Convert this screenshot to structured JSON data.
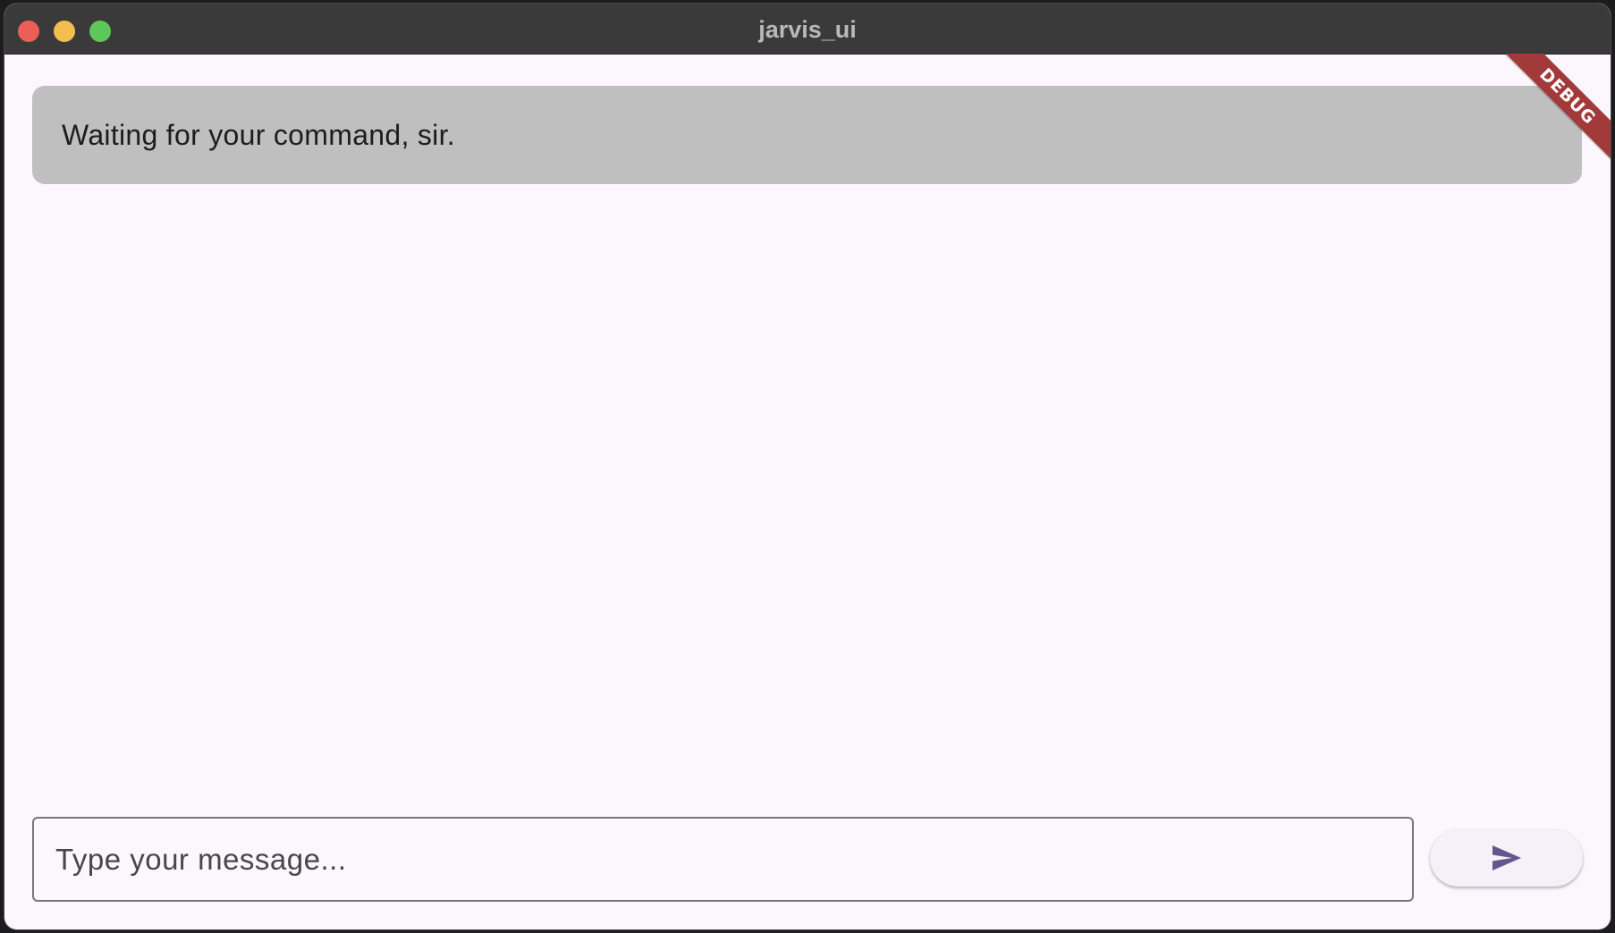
{
  "window": {
    "title": "jarvis_ui"
  },
  "chat": {
    "messages": [
      {
        "text": "Waiting for your command, sir."
      }
    ]
  },
  "composer": {
    "placeholder": "Type your message...",
    "value": "",
    "send_icon": "send-icon"
  },
  "debug_banner": {
    "label": "DEBUG"
  },
  "colors": {
    "titlebar": "#3a3a3a",
    "background": "#fcf7fc",
    "bubble": "#bfbfbf",
    "accent": "#65558f",
    "debug_ribbon": "#a33a3a"
  }
}
